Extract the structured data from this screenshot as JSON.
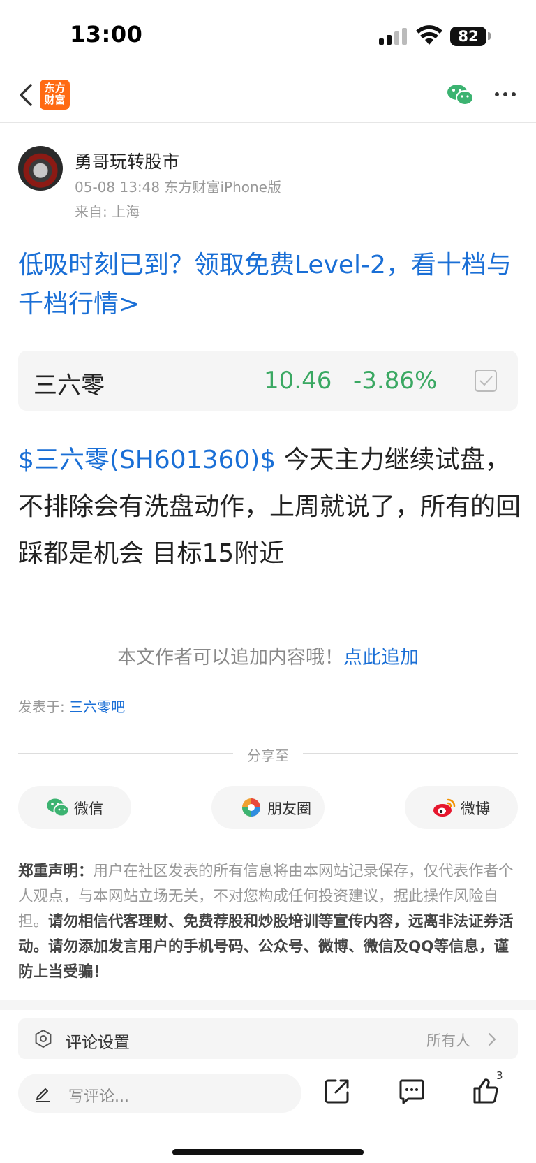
{
  "status_bar": {
    "time": "13:00",
    "battery": "82"
  },
  "nav": {
    "logo_line1": "东方",
    "logo_line2": "财富"
  },
  "author": {
    "name": "勇哥玩转股市",
    "meta": "05-08 13:48 东方财富iPhone版",
    "location": "来自: 上海"
  },
  "promo": {
    "text": "低吸时刻已到？领取免费Level-2，看十档与千档行情>"
  },
  "stock_card": {
    "name": "三六零",
    "price": "10.46",
    "change": "-3.86%"
  },
  "post": {
    "stock_tag": "$三六零(SH601360)$",
    "body": "  今天主力继续试盘，不排除会有洗盘动作，上周就说了，所有的回踩都是机会 目标15附近"
  },
  "append": {
    "text": "本文作者可以追加内容哦！",
    "link": "点此追加"
  },
  "posted_in": {
    "label": "发表于: ",
    "forum": "三六零吧"
  },
  "share": {
    "title": "分享至",
    "wechat": "微信",
    "moments": "朋友圈",
    "weibo": "微博"
  },
  "disclaimer": {
    "label": "郑重声明：",
    "text": "用户在社区发表的所有信息将由本网站记录保存，仅代表作者个人观点，与本网站立场无关，不对您构成任何投资建议，据此操作风险自担。",
    "warning": "请勿相信代客理财、免费荐股和炒股培训等宣传内容，远离非法证券活动。请勿添加发言用户的手机号码、公众号、微博、微信及QQ等信息，谨防上当受骗！"
  },
  "comment_settings": {
    "title": "评论设置",
    "value": "所有人"
  },
  "bottom_bar": {
    "placeholder": "写评论...",
    "like_count": "3"
  },
  "colors": {
    "link_blue": "#1a6fd6",
    "stock_green": "#3aa862",
    "brand_orange": "#ff6a13"
  }
}
